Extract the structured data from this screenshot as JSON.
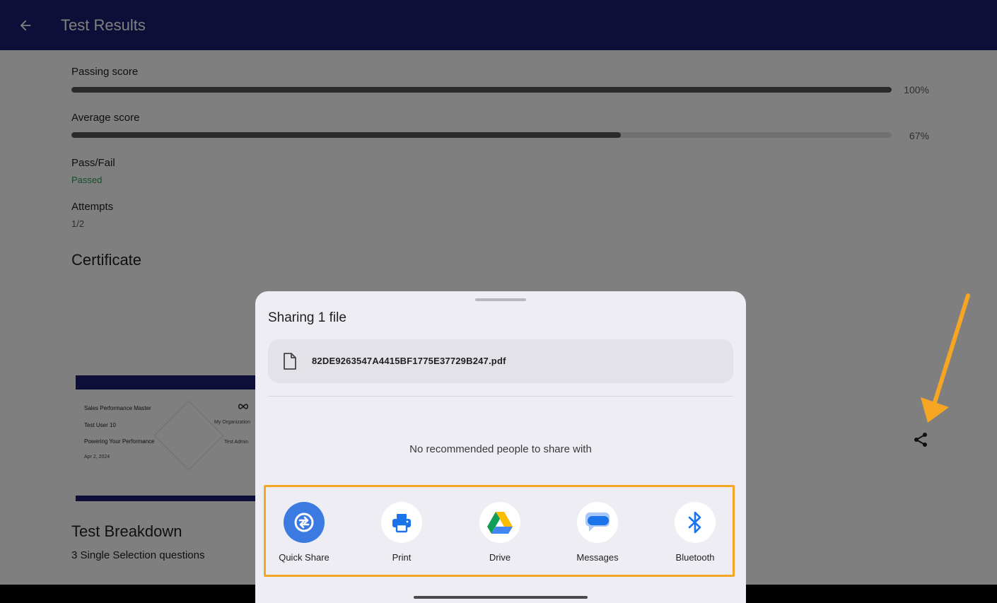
{
  "appbar": {
    "title": "Test Results",
    "back_icon": "arrow-back-icon",
    "background": "#1a1f71"
  },
  "metrics": {
    "passing": {
      "label": "Passing score",
      "value_text": "100%",
      "fraction": 1.0
    },
    "average": {
      "label": "Average score",
      "value_text": "67%",
      "fraction": 0.67
    },
    "pass_fail": {
      "label": "Pass/Fail",
      "value": "Passed",
      "color": "#2e9a5e"
    },
    "attempts": {
      "label": "Attempts",
      "value": "1/2"
    }
  },
  "certificate": {
    "title": "Certificate",
    "thumb": {
      "course": "Sales Performance Master",
      "user": "Test User 10",
      "program": "Powering Your Performance",
      "date": "Apr 2, 2024",
      "org": "My Organization",
      "admin": "Test Admin"
    },
    "share_icon": "share-icon"
  },
  "breakdown": {
    "title": "Test Breakdown",
    "summary": "3 Single Selection questions"
  },
  "share_sheet": {
    "title": "Sharing 1 file",
    "file_name": "82DE9263547A4415BF1775E37729B247.pdf",
    "file_icon": "document-icon",
    "no_people": "No recommended people to share with",
    "targets": [
      {
        "label": "Quick Share",
        "icon": "quick-share-icon"
      },
      {
        "label": "Print",
        "icon": "print-icon"
      },
      {
        "label": "Drive",
        "icon": "drive-icon"
      },
      {
        "label": "Messages",
        "icon": "messages-icon"
      },
      {
        "label": "Bluetooth",
        "icon": "bluetooth-icon"
      }
    ],
    "highlight_color": "#f6a623"
  }
}
